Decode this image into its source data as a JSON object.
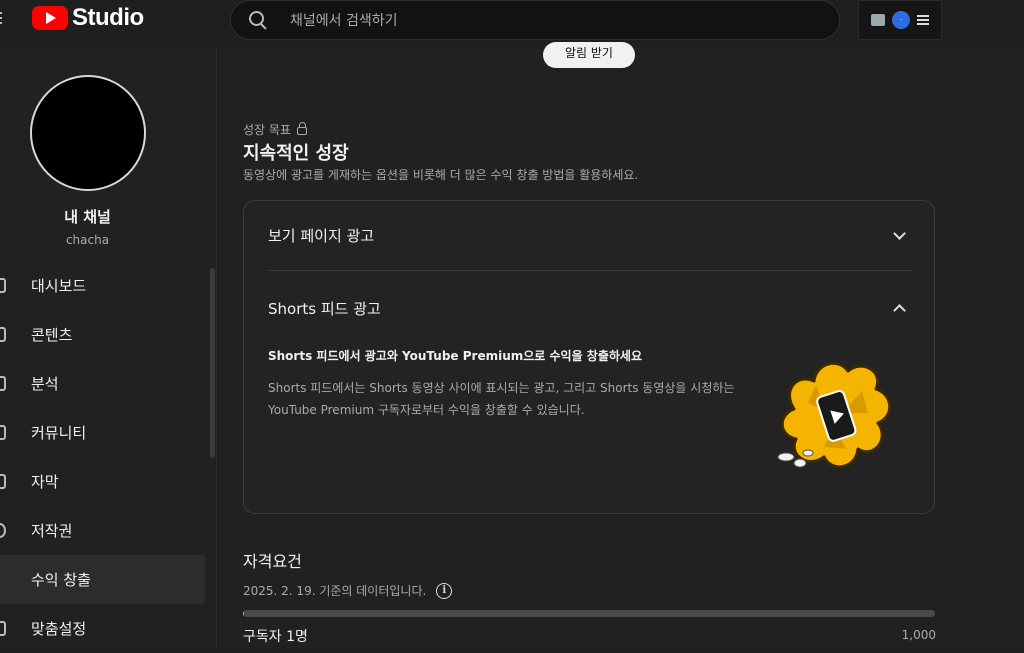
{
  "header": {
    "logo_text": "Studio",
    "search_placeholder": "채널에서 검색하기",
    "avatar_text": "·"
  },
  "sidebar": {
    "channel_name": "내 채널",
    "channel_handle": "chacha",
    "items": [
      {
        "label": "대시보드",
        "icon": "dashboard-icon"
      },
      {
        "label": "콘텐츠",
        "icon": "content-icon"
      },
      {
        "label": "분석",
        "icon": "analytics-icon"
      },
      {
        "label": "커뮤니티",
        "icon": "community-icon"
      },
      {
        "label": "자막",
        "icon": "subtitles-icon"
      },
      {
        "label": "저작권",
        "icon": "copyright-icon"
      },
      {
        "label": "수익 창출",
        "icon": "monetization-icon",
        "active": true
      },
      {
        "label": "맞춤설정",
        "icon": "customization-icon"
      }
    ]
  },
  "main": {
    "pill_button": "알림 받기",
    "goal": {
      "kicker": "성장 목표",
      "title": "지속적인 성장",
      "desc": "동영상에 광고를 게재하는 옵션을 비롯해 더 많은 수익 창출 방법을 활용하세요."
    },
    "accordion": {
      "row1_title": "보기 페이지 광고",
      "row2_title": "Shorts 피드 광고",
      "shorts_headline": "Shorts 피드에서 광고와 YouTube Premium으로 수익을 창출하세요",
      "shorts_desc": "Shorts 피드에서는 Shorts 동영상 사이에 표시되는 광고, 그리고 Shorts 동영상을 시청하는 YouTube Premium 구독자로부터 수익을 창출할 수 있습니다."
    },
    "requirements": {
      "title": "자격요건",
      "date": "2025. 2. 19. 기준의 데이터입니다.",
      "subs_label": "구독자 1명",
      "subs_target": "1,000",
      "progress_fraction": 0.001
    }
  },
  "colors": {
    "brand_red": "#ff0000",
    "background": "#212121",
    "illustration_yellow": "#f5b400"
  }
}
